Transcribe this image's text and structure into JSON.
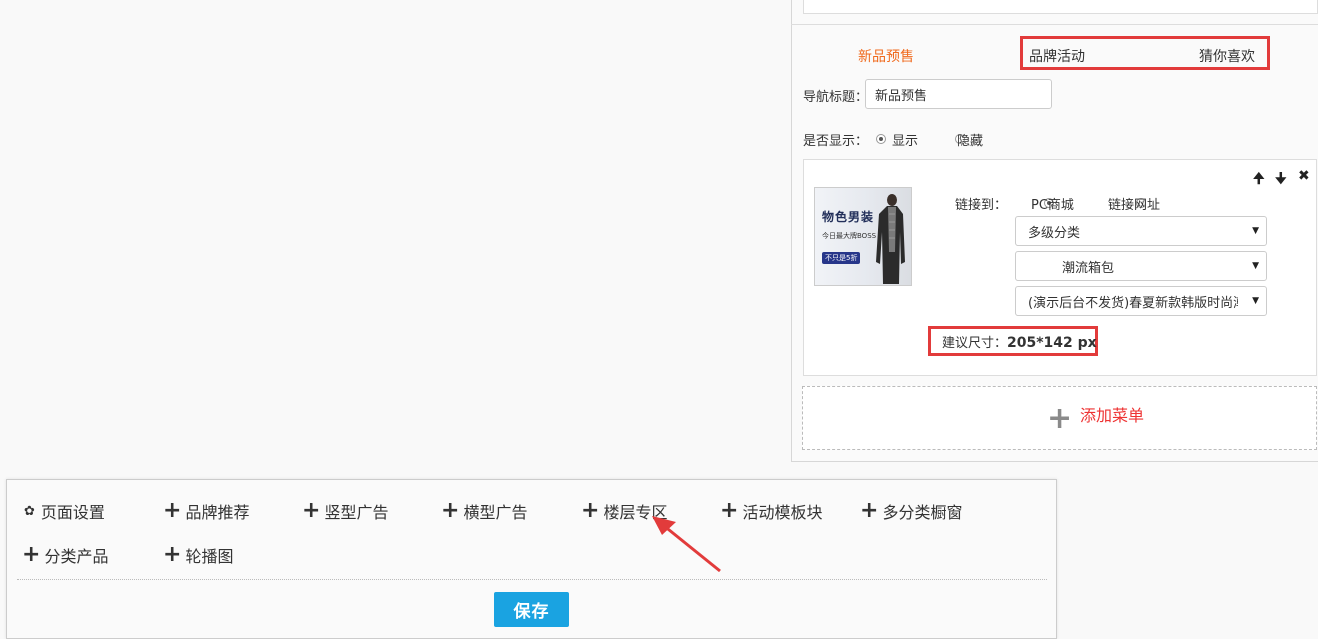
{
  "nav_tabs": {
    "active": "新品预售",
    "brand": "品牌活动",
    "guess": "猜你喜欢"
  },
  "nav_title": {
    "label": "导航标题：",
    "value": "新品预售"
  },
  "display": {
    "label": "是否显示：",
    "show": "显示",
    "hide": "隐藏",
    "selected": "显示"
  },
  "item_controls": {
    "up": "🠉",
    "down": "🠋",
    "close": "✖"
  },
  "thumbnail": {
    "title": "物色男装",
    "subtitle": "今日最大牌BOSS",
    "badge": "不只是5折"
  },
  "link": {
    "label": "链接到：",
    "option_pc": "PC商城",
    "option_url": "链接网址",
    "selected": "PC商城",
    "select1": "多级分类",
    "select2": "潮流箱包",
    "select3": "(演示后台不发货)春夏新款韩版时尚潮"
  },
  "suggest": {
    "label": "建议尺寸：",
    "size": "205*142 px"
  },
  "add_menu": {
    "plus": "+",
    "label": "添加菜单"
  },
  "toolbar": {
    "page_settings": "页面设置",
    "brand_recommend": "品牌推荐",
    "vertical_ad": "竖型广告",
    "horizontal_ad": "横型广告",
    "floor_zone": "楼层专区",
    "activity_template": "活动模板块",
    "multi_category_window": "多分类橱窗",
    "category_products": "分类产品",
    "carousel": "轮播图",
    "save": "保存"
  },
  "colors": {
    "active_tab": "#f06a1d",
    "highlight": "#e23b3b",
    "save_button": "#1aa3e1",
    "add_menu_text": "#ee3333"
  }
}
